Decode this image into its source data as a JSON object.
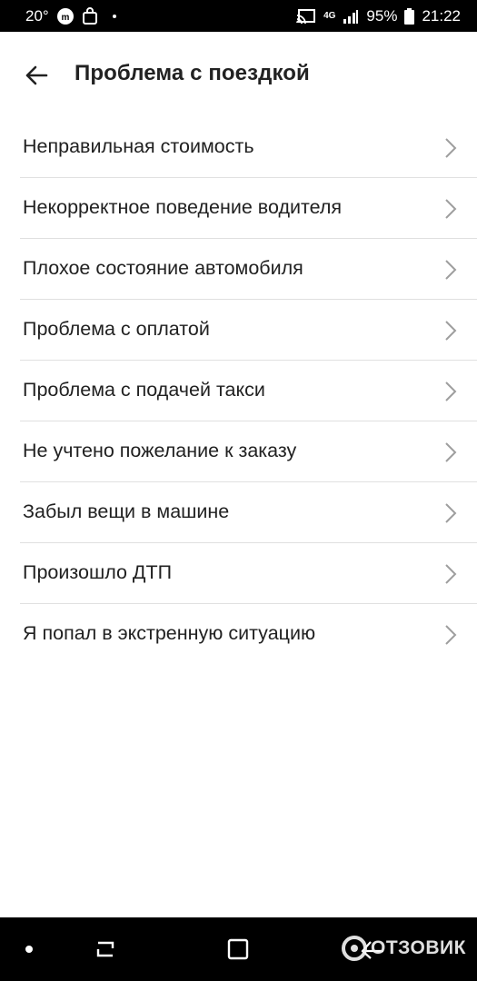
{
  "status_bar": {
    "temperature": "20°",
    "network": "4G",
    "battery": "95%",
    "time": "21:22"
  },
  "header": {
    "title": "Проблема с поездкой",
    "back_icon": "arrow-left-icon"
  },
  "items": [
    {
      "label": "Неправильная стоимость"
    },
    {
      "label": "Некорректное поведение водителя"
    },
    {
      "label": "Плохое состояние автомобиля"
    },
    {
      "label": "Проблема с оплатой"
    },
    {
      "label": "Проблема с подачей такси"
    },
    {
      "label": "Не учтено пожелание к заказу"
    },
    {
      "label": "Забыл вещи в машине"
    },
    {
      "label": "Произошло ДТП"
    },
    {
      "label": "Я попал в экстренную ситуацию"
    }
  ],
  "watermark": {
    "text": "ОТЗОВИК"
  },
  "colors": {
    "text": "#212121",
    "divider": "#e0e0e0",
    "chevron": "#9e9e9e",
    "bars": "#000000"
  }
}
